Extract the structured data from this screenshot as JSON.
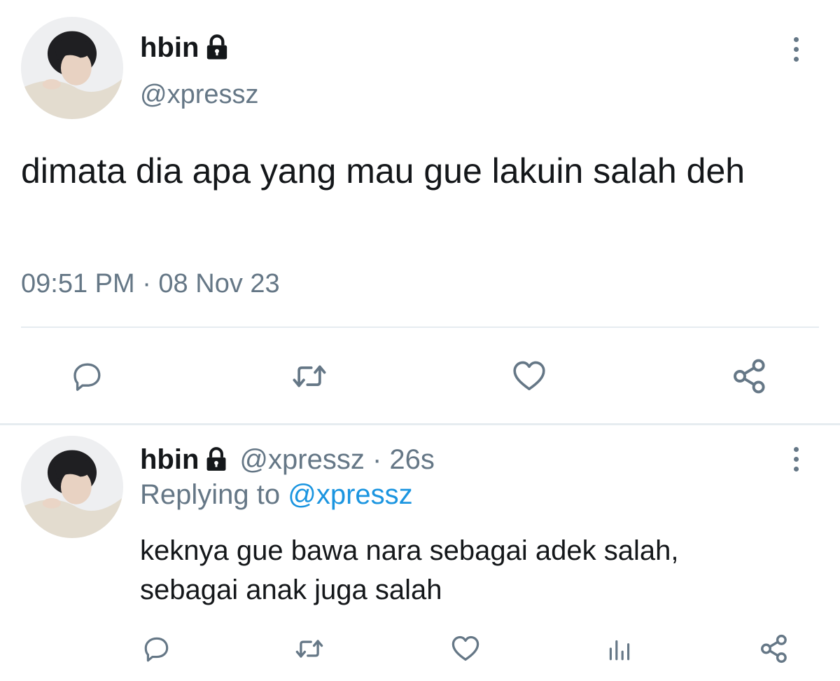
{
  "main_tweet": {
    "author": {
      "display_name": "hbin",
      "handle": "@xpressz",
      "avatar": "avatar-photo",
      "protected_icon": "lock-icon"
    },
    "text": "dimata dia apa yang mau gue lakuin salah deh",
    "timestamp": "09:51 PM · 08 Nov 23",
    "actions": [
      {
        "icon": "reply-icon"
      },
      {
        "icon": "retweet-icon"
      },
      {
        "icon": "like-icon"
      },
      {
        "icon": "share-icon"
      }
    ],
    "menu_icon": "more-vertical-icon"
  },
  "reply_tweet": {
    "author": {
      "display_name": "hbin",
      "handle": "@xpressz",
      "avatar": "avatar-photo",
      "protected_icon": "lock-icon"
    },
    "meta_separator": "·",
    "age": "26s",
    "replying_prefix": "Replying to",
    "replying_to": "@xpressz",
    "text_line_1": "keknya gue bawa nara sebagai adek salah,",
    "text_line_2": "sebagai anak juga salah",
    "actions": [
      {
        "icon": "reply-icon"
      },
      {
        "icon": "retweet-icon"
      },
      {
        "icon": "like-icon"
      },
      {
        "icon": "analytics-icon"
      },
      {
        "icon": "share-icon"
      }
    ],
    "menu_icon": "more-vertical-icon"
  },
  "colors": {
    "text": "#14171a",
    "secondary": "#657786",
    "link": "#1b95e0",
    "divider": "#e6ecf0"
  }
}
